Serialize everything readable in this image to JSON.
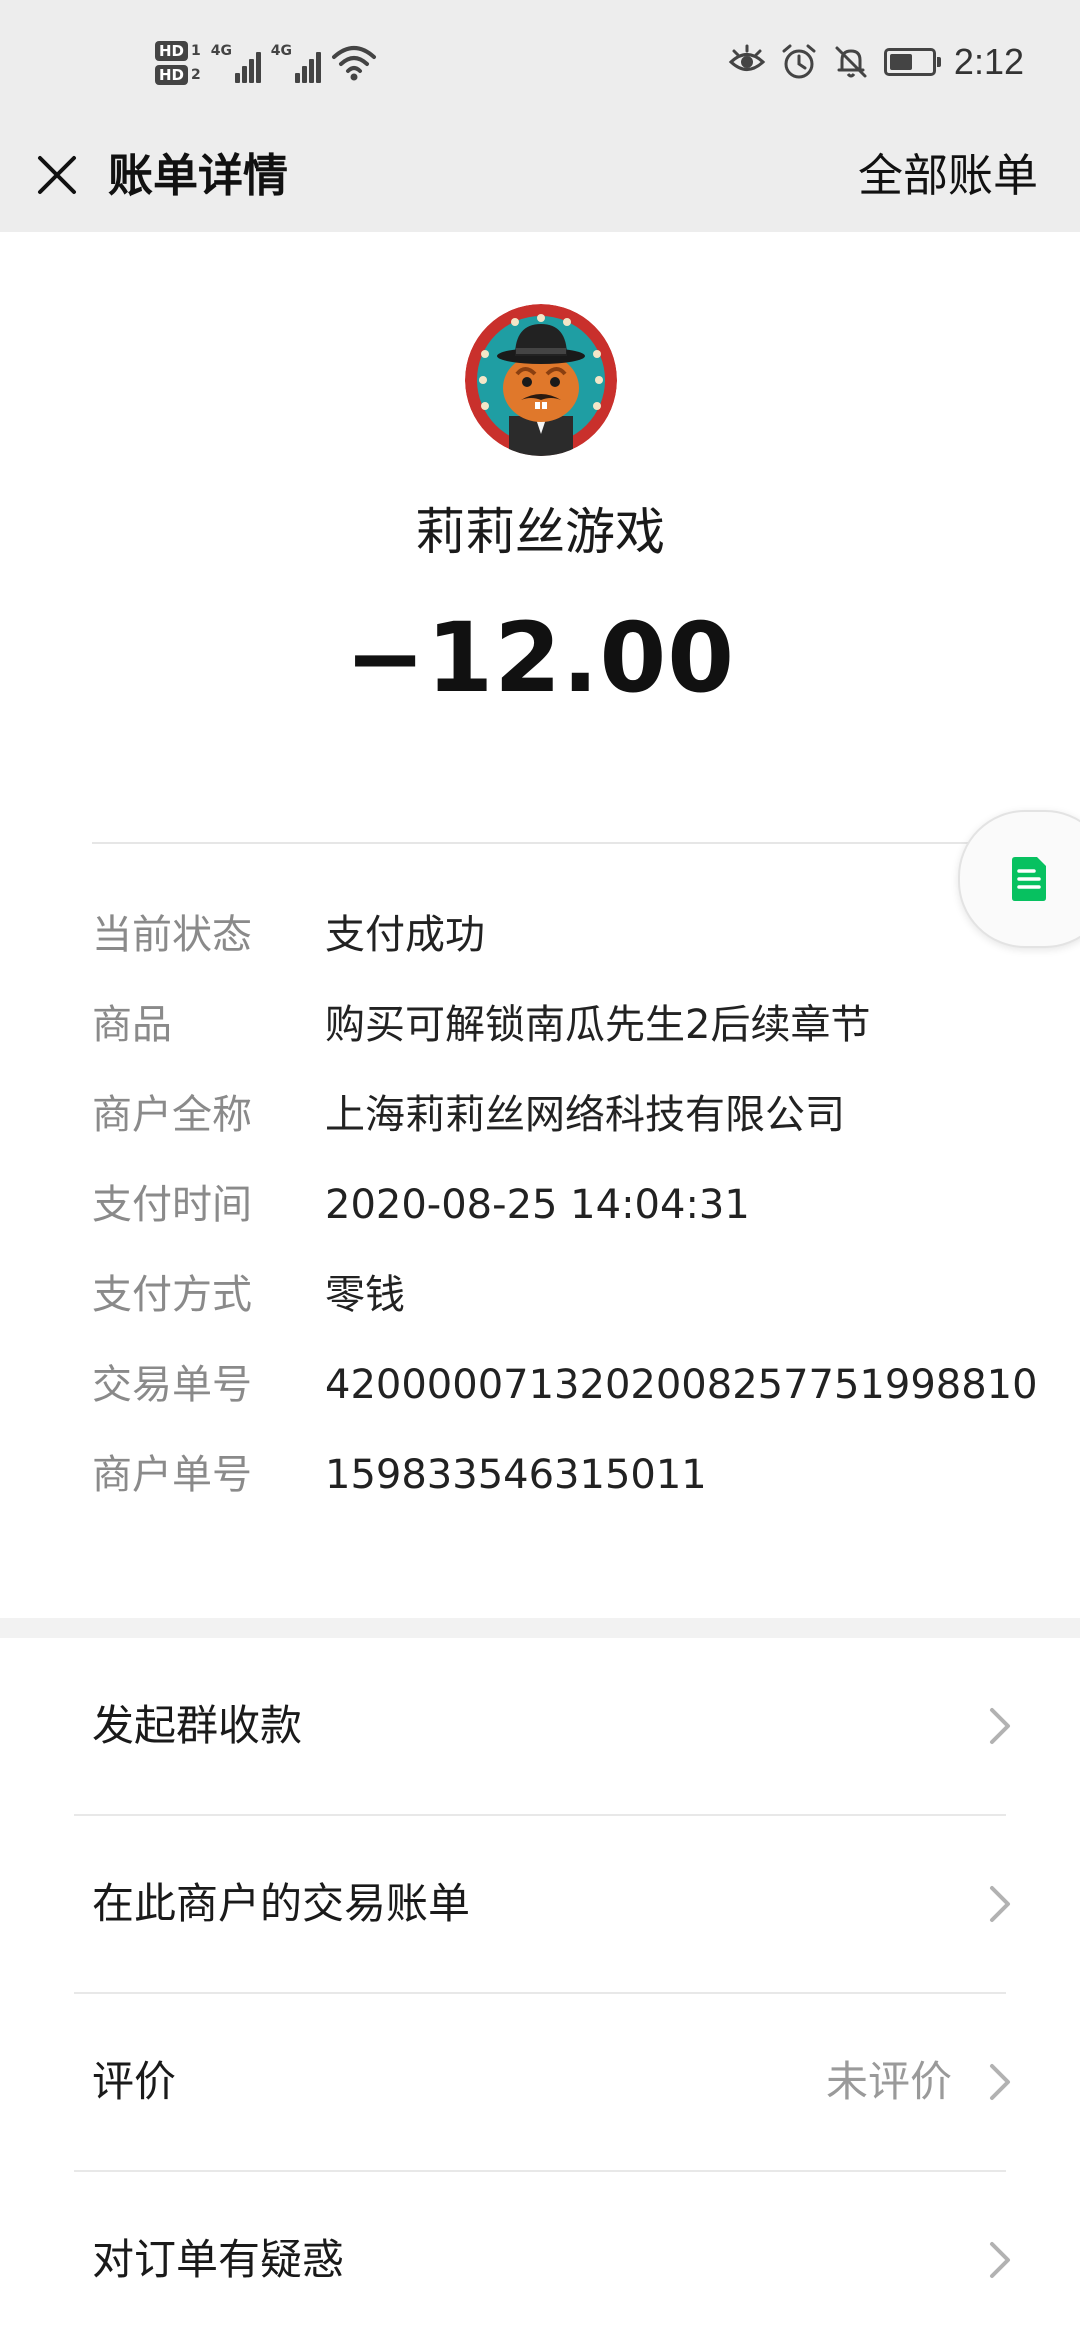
{
  "status_bar": {
    "hd1": "HD",
    "hd1_num": "1",
    "hd2": "HD",
    "hd2_num": "2",
    "net1": "4G",
    "net2": "4G",
    "time": "2:12",
    "battery_level": 0.55
  },
  "nav": {
    "title": "账单详情",
    "right_label": "全部账单"
  },
  "merchant": {
    "name": "莉莉丝游戏",
    "amount": "−12.00"
  },
  "details": [
    {
      "key": "当前状态",
      "value": "支付成功"
    },
    {
      "key": "商品",
      "value": "购买可解锁南瓜先生2后续章节"
    },
    {
      "key": "商户全称",
      "value": "上海莉莉丝网络科技有限公司"
    },
    {
      "key": "支付时间",
      "value": "2020-08-25 14:04:31"
    },
    {
      "key": "支付方式",
      "value": "零钱"
    },
    {
      "key": "交易单号",
      "value": "4200000713202008257751998810"
    },
    {
      "key": "商户单号",
      "value": "159833546315011"
    }
  ],
  "menu": [
    {
      "label": "发起群收款",
      "extra": ""
    },
    {
      "label": "在此商户的交易账单",
      "extra": ""
    },
    {
      "label": "评价",
      "extra": "未评价"
    },
    {
      "label": "对订单有疑惑",
      "extra": ""
    }
  ],
  "colors": {
    "header_bg": "#ededed",
    "muted_text": "#8a8a8a",
    "accent_green": "#07c160"
  }
}
